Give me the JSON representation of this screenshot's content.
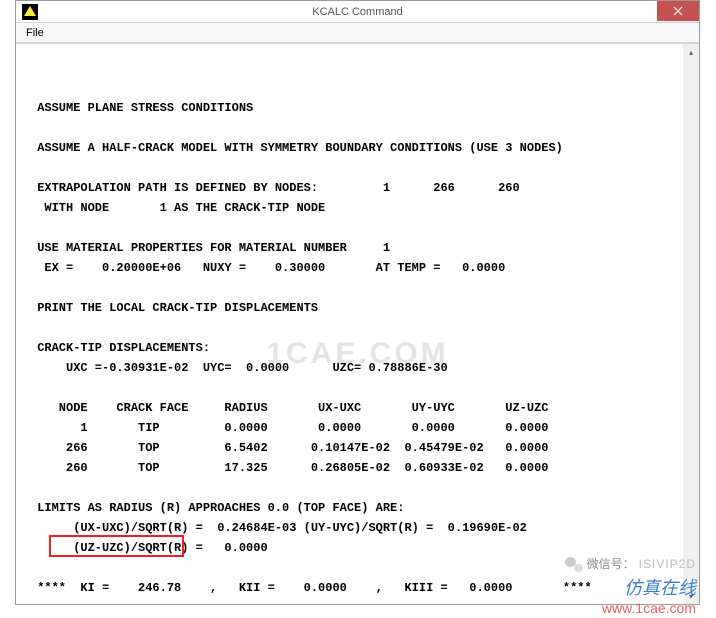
{
  "window": {
    "title": "KCALC  Command"
  },
  "menu": {
    "file": "File"
  },
  "watermark": "1CAE.COM",
  "output": {
    "l1": " ASSUME PLANE STRESS CONDITIONS",
    "l2": "",
    "l3": " ASSUME A HALF-CRACK MODEL WITH SYMMETRY BOUNDARY CONDITIONS (USE 3 NODES)",
    "l4": "",
    "l5": " EXTRAPOLATION PATH IS DEFINED BY NODES:         1      266      260",
    "l6": "  WITH NODE       1 AS THE CRACK-TIP NODE",
    "l7": "",
    "l8": " USE MATERIAL PROPERTIES FOR MATERIAL NUMBER     1",
    "l9": "  EX =    0.20000E+06   NUXY =    0.30000       AT TEMP =   0.0000",
    "l10": "",
    "l11": " PRINT THE LOCAL CRACK-TIP DISPLACEMENTS",
    "l12": "",
    "l13": " CRACK-TIP DISPLACEMENTS:",
    "l14": "     UXC =-0.30931E-02  UYC=  0.0000      UZC= 0.78886E-30",
    "l15": "",
    "l16": "    NODE    CRACK FACE     RADIUS       UX-UXC       UY-UYC       UZ-UZC",
    "l17": "       1       TIP         0.0000       0.0000       0.0000       0.0000",
    "l18": "     266       TOP         6.5402      0.10147E-02  0.45479E-02   0.0000",
    "l19": "     260       TOP         17.325      0.26805E-02  0.60933E-02   0.0000",
    "l20": "",
    "l21": " LIMITS AS RADIUS (R) APPROACHES 0.0 (TOP FACE) ARE:",
    "l22": "      (UX-UXC)/SQRT(R) =  0.24684E-03 (UY-UYC)/SQRT(R) =  0.19690E-02",
    "l23": "      (UZ-UZC)/SQRT(R) =   0.0000",
    "l24": "",
    "l25": " ****  KI =    246.78    ,   KII =    0.0000    ,   KIII =   0.0000       ****"
  },
  "brand": {
    "wechat_label": "微信号：",
    "wechat_id": "ISIVIP2D",
    "name": "仿真在线",
    "url": "www.1cae.com"
  }
}
